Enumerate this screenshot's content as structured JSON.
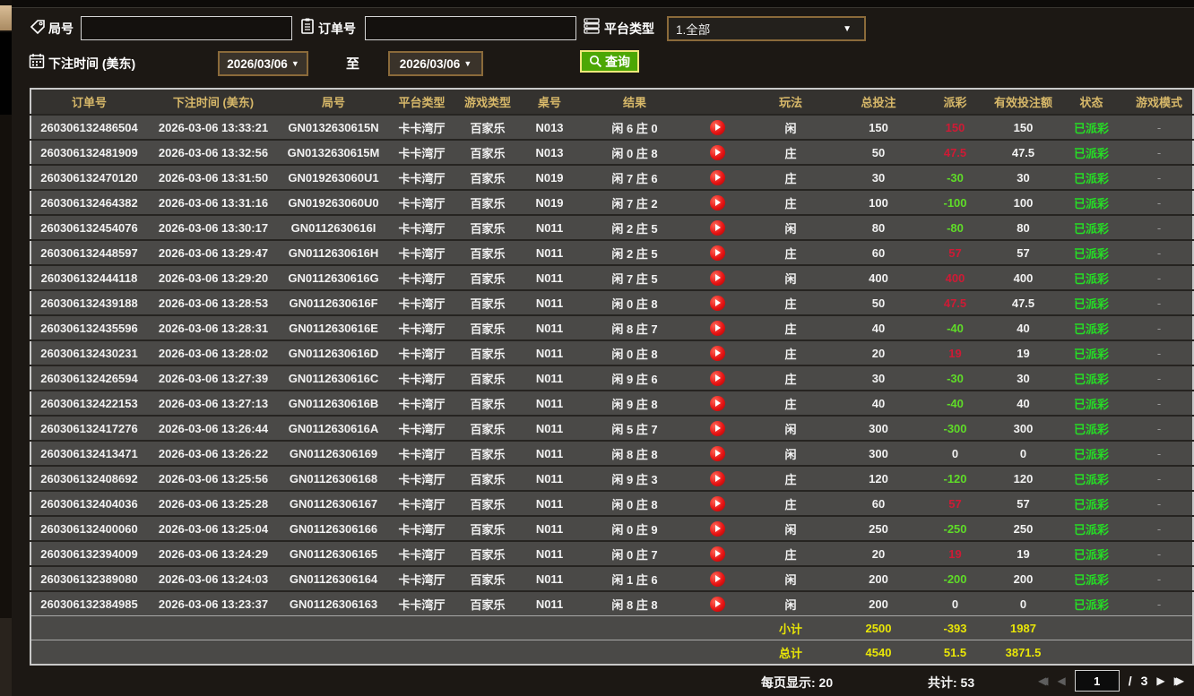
{
  "filters": {
    "round_label": "局号",
    "round_value": "",
    "order_label": "订单号",
    "order_value": "",
    "platform_label": "平台类型",
    "platform_value": "1.全部",
    "bet_time_label": "下注时间 (美东)",
    "date_from": "2026/03/06",
    "to_label": "至",
    "date_to": "2026/03/06",
    "search_label": "查询"
  },
  "icons": {
    "round": "tag-icon",
    "order": "clipboard-icon",
    "platform": "server-icon",
    "bet_time": "calendar-icon",
    "search": "magnifier-icon",
    "replay": "play-icon",
    "pagination": [
      "first-page-icon",
      "prev-page-icon",
      "next-page-icon",
      "last-page-icon"
    ]
  },
  "colors": {
    "header_gold": "#d7b869",
    "payout_win_red": "#cf1a35",
    "payout_loss_green": "#5fdc28",
    "status_green": "#25dd25",
    "totals_yellow": "#e9e607",
    "search_green": "#4ca705",
    "search_border_yellow": "#f0e87a",
    "date_border_brown": "#8a6a3a",
    "row_bg": "#4a4947",
    "header_bg": "#34322f"
  },
  "table": {
    "columns": [
      "订单号",
      "下注时间 (美东)",
      "局号",
      "平台类型",
      "游戏类型",
      "桌号",
      "结果",
      "",
      "玩法",
      "总投注",
      "派彩",
      "有效投注额",
      "状态",
      "游戏模式"
    ],
    "rows": [
      {
        "order": "260306132486504",
        "time": "2026-03-06 13:33:21",
        "round": "GN0132630615N",
        "platform": "卡卡湾厅",
        "game": "百家乐",
        "table_no": "N013",
        "result": "闲 6 庄 0",
        "bet_side": "闲",
        "total_bet": "150",
        "payout": "150",
        "payout_class": "win",
        "valid_bet": "150",
        "status": "已派彩",
        "mode": "-"
      },
      {
        "order": "260306132481909",
        "time": "2026-03-06 13:32:56",
        "round": "GN0132630615M",
        "platform": "卡卡湾厅",
        "game": "百家乐",
        "table_no": "N013",
        "result": "闲 0 庄 8",
        "bet_side": "庄",
        "total_bet": "50",
        "payout": "47.5",
        "payout_class": "win",
        "valid_bet": "47.5",
        "status": "已派彩",
        "mode": "-"
      },
      {
        "order": "260306132470120",
        "time": "2026-03-06 13:31:50",
        "round": "GN019263060U1",
        "platform": "卡卡湾厅",
        "game": "百家乐",
        "table_no": "N019",
        "result": "闲 7 庄 6",
        "bet_side": "庄",
        "total_bet": "30",
        "payout": "-30",
        "payout_class": "loss",
        "valid_bet": "30",
        "status": "已派彩",
        "mode": "-"
      },
      {
        "order": "260306132464382",
        "time": "2026-03-06 13:31:16",
        "round": "GN019263060U0",
        "platform": "卡卡湾厅",
        "game": "百家乐",
        "table_no": "N019",
        "result": "闲 7 庄 2",
        "bet_side": "庄",
        "total_bet": "100",
        "payout": "-100",
        "payout_class": "loss",
        "valid_bet": "100",
        "status": "已派彩",
        "mode": "-"
      },
      {
        "order": "260306132454076",
        "time": "2026-03-06 13:30:17",
        "round": "GN0112630616I",
        "platform": "卡卡湾厅",
        "game": "百家乐",
        "table_no": "N011",
        "result": "闲 2 庄 5",
        "bet_side": "闲",
        "total_bet": "80",
        "payout": "-80",
        "payout_class": "loss",
        "valid_bet": "80",
        "status": "已派彩",
        "mode": "-"
      },
      {
        "order": "260306132448597",
        "time": "2026-03-06 13:29:47",
        "round": "GN0112630616H",
        "platform": "卡卡湾厅",
        "game": "百家乐",
        "table_no": "N011",
        "result": "闲 2 庄 5",
        "bet_side": "庄",
        "total_bet": "60",
        "payout": "57",
        "payout_class": "win",
        "valid_bet": "57",
        "status": "已派彩",
        "mode": "-"
      },
      {
        "order": "260306132444118",
        "time": "2026-03-06 13:29:20",
        "round": "GN0112630616G",
        "platform": "卡卡湾厅",
        "game": "百家乐",
        "table_no": "N011",
        "result": "闲 7 庄 5",
        "bet_side": "闲",
        "total_bet": "400",
        "payout": "400",
        "payout_class": "win",
        "valid_bet": "400",
        "status": "已派彩",
        "mode": "-"
      },
      {
        "order": "260306132439188",
        "time": "2026-03-06 13:28:53",
        "round": "GN0112630616F",
        "platform": "卡卡湾厅",
        "game": "百家乐",
        "table_no": "N011",
        "result": "闲 0 庄 8",
        "bet_side": "庄",
        "total_bet": "50",
        "payout": "47.5",
        "payout_class": "win",
        "valid_bet": "47.5",
        "status": "已派彩",
        "mode": "-"
      },
      {
        "order": "260306132435596",
        "time": "2026-03-06 13:28:31",
        "round": "GN0112630616E",
        "platform": "卡卡湾厅",
        "game": "百家乐",
        "table_no": "N011",
        "result": "闲 8 庄 7",
        "bet_side": "庄",
        "total_bet": "40",
        "payout": "-40",
        "payout_class": "loss",
        "valid_bet": "40",
        "status": "已派彩",
        "mode": "-"
      },
      {
        "order": "260306132430231",
        "time": "2026-03-06 13:28:02",
        "round": "GN0112630616D",
        "platform": "卡卡湾厅",
        "game": "百家乐",
        "table_no": "N011",
        "result": "闲 0 庄 8",
        "bet_side": "庄",
        "total_bet": "20",
        "payout": "19",
        "payout_class": "win",
        "valid_bet": "19",
        "status": "已派彩",
        "mode": "-"
      },
      {
        "order": "260306132426594",
        "time": "2026-03-06 13:27:39",
        "round": "GN0112630616C",
        "platform": "卡卡湾厅",
        "game": "百家乐",
        "table_no": "N011",
        "result": "闲 9 庄 6",
        "bet_side": "庄",
        "total_bet": "30",
        "payout": "-30",
        "payout_class": "loss",
        "valid_bet": "30",
        "status": "已派彩",
        "mode": "-"
      },
      {
        "order": "260306132422153",
        "time": "2026-03-06 13:27:13",
        "round": "GN0112630616B",
        "platform": "卡卡湾厅",
        "game": "百家乐",
        "table_no": "N011",
        "result": "闲 9 庄 8",
        "bet_side": "庄",
        "total_bet": "40",
        "payout": "-40",
        "payout_class": "loss",
        "valid_bet": "40",
        "status": "已派彩",
        "mode": "-"
      },
      {
        "order": "260306132417276",
        "time": "2026-03-06 13:26:44",
        "round": "GN0112630616A",
        "platform": "卡卡湾厅",
        "game": "百家乐",
        "table_no": "N011",
        "result": "闲 5 庄 7",
        "bet_side": "闲",
        "total_bet": "300",
        "payout": "-300",
        "payout_class": "loss",
        "valid_bet": "300",
        "status": "已派彩",
        "mode": "-"
      },
      {
        "order": "260306132413471",
        "time": "2026-03-06 13:26:22",
        "round": "GN01126306169",
        "platform": "卡卡湾厅",
        "game": "百家乐",
        "table_no": "N011",
        "result": "闲 8 庄 8",
        "bet_side": "闲",
        "total_bet": "300",
        "payout": "0",
        "payout_class": "zero",
        "valid_bet": "0",
        "status": "已派彩",
        "mode": "-"
      },
      {
        "order": "260306132408692",
        "time": "2026-03-06 13:25:56",
        "round": "GN01126306168",
        "platform": "卡卡湾厅",
        "game": "百家乐",
        "table_no": "N011",
        "result": "闲 9 庄 3",
        "bet_side": "庄",
        "total_bet": "120",
        "payout": "-120",
        "payout_class": "loss",
        "valid_bet": "120",
        "status": "已派彩",
        "mode": "-"
      },
      {
        "order": "260306132404036",
        "time": "2026-03-06 13:25:28",
        "round": "GN01126306167",
        "platform": "卡卡湾厅",
        "game": "百家乐",
        "table_no": "N011",
        "result": "闲 0 庄 8",
        "bet_side": "庄",
        "total_bet": "60",
        "payout": "57",
        "payout_class": "win",
        "valid_bet": "57",
        "status": "已派彩",
        "mode": "-"
      },
      {
        "order": "260306132400060",
        "time": "2026-03-06 13:25:04",
        "round": "GN01126306166",
        "platform": "卡卡湾厅",
        "game": "百家乐",
        "table_no": "N011",
        "result": "闲 0 庄 9",
        "bet_side": "闲",
        "total_bet": "250",
        "payout": "-250",
        "payout_class": "loss",
        "valid_bet": "250",
        "status": "已派彩",
        "mode": "-"
      },
      {
        "order": "260306132394009",
        "time": "2026-03-06 13:24:29",
        "round": "GN01126306165",
        "platform": "卡卡湾厅",
        "game": "百家乐",
        "table_no": "N011",
        "result": "闲 0 庄 7",
        "bet_side": "庄",
        "total_bet": "20",
        "payout": "19",
        "payout_class": "win",
        "valid_bet": "19",
        "status": "已派彩",
        "mode": "-"
      },
      {
        "order": "260306132389080",
        "time": "2026-03-06 13:24:03",
        "round": "GN01126306164",
        "platform": "卡卡湾厅",
        "game": "百家乐",
        "table_no": "N011",
        "result": "闲 1 庄 6",
        "bet_side": "闲",
        "total_bet": "200",
        "payout": "-200",
        "payout_class": "loss",
        "valid_bet": "200",
        "status": "已派彩",
        "mode": "-"
      },
      {
        "order": "260306132384985",
        "time": "2026-03-06 13:23:37",
        "round": "GN01126306163",
        "platform": "卡卡湾厅",
        "game": "百家乐",
        "table_no": "N011",
        "result": "闲 8 庄 8",
        "bet_side": "闲",
        "total_bet": "200",
        "payout": "0",
        "payout_class": "zero",
        "valid_bet": "0",
        "status": "已派彩",
        "mode": "-"
      }
    ],
    "subtotal": {
      "label": "小计",
      "total_bet": "2500",
      "payout": "-393",
      "valid_bet": "1987"
    },
    "grand_total": {
      "label": "总计",
      "total_bet": "4540",
      "payout": "51.5",
      "valid_bet": "3871.5"
    }
  },
  "footer": {
    "per_page_text": "每页显示: 20",
    "total_count_text": "共计: 53",
    "current_page": "1",
    "page_separator": "/",
    "total_pages": "3"
  }
}
